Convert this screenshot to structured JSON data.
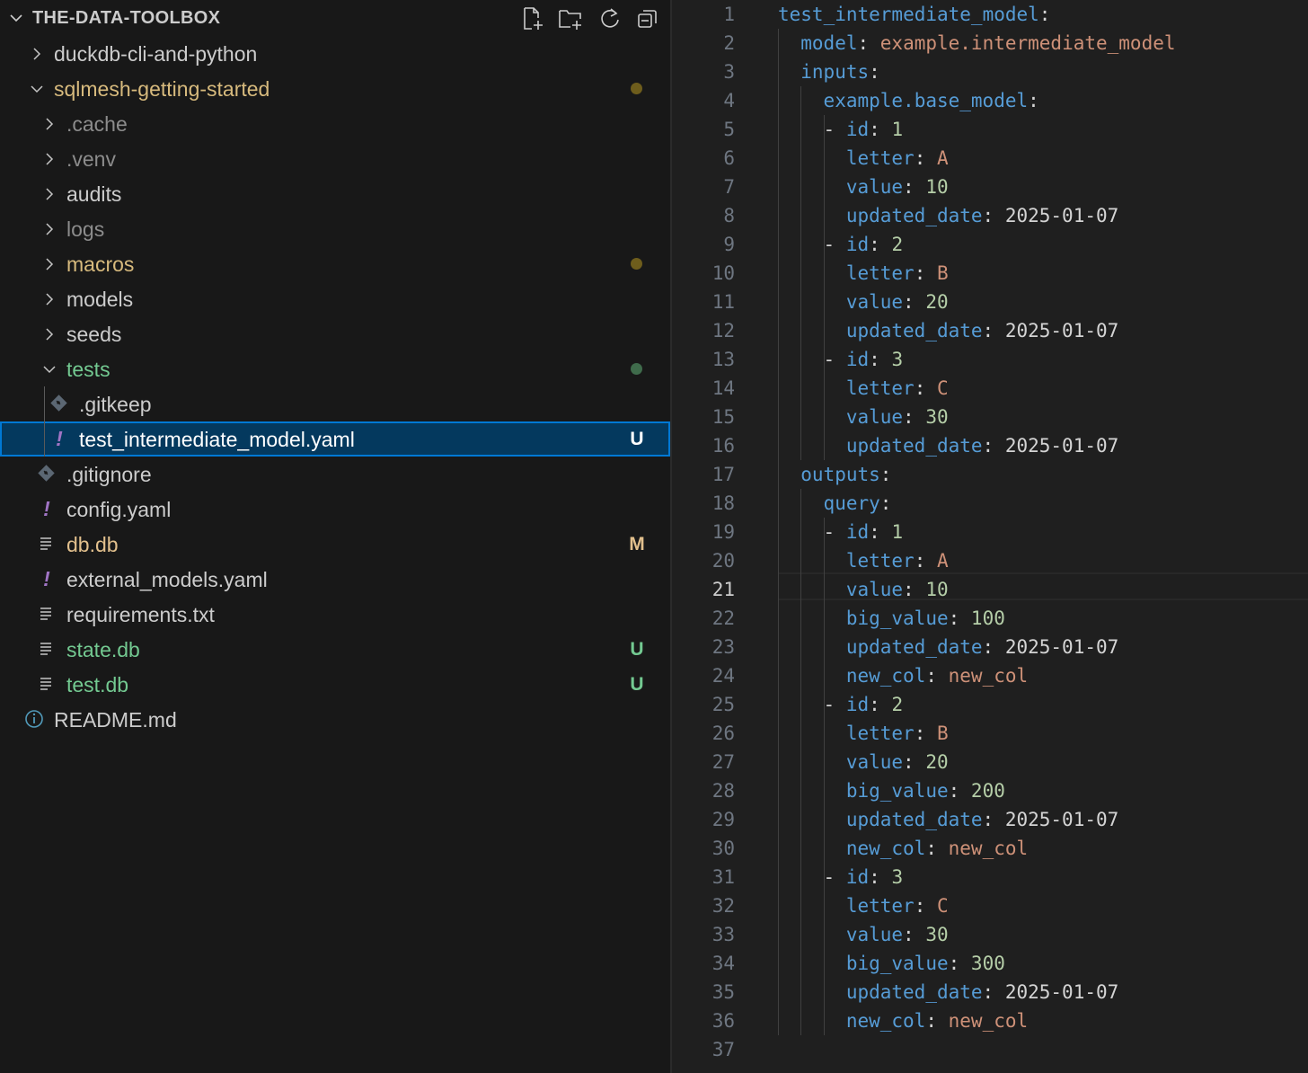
{
  "explorer": {
    "title": "THE-DATA-TOOLBOX",
    "actions": [
      "new-file-icon",
      "new-folder-icon",
      "refresh-icon",
      "collapse-all-icon"
    ],
    "items": [
      {
        "label": "duckdb-cli-and-python",
        "type": "folder",
        "expanded": false,
        "depth": 0,
        "status": "default"
      },
      {
        "label": "sqlmesh-getting-started",
        "type": "folder",
        "expanded": true,
        "depth": 0,
        "status": "modified",
        "decoration": "dot",
        "dot_color": "#6e5d1c"
      },
      {
        "label": ".cache",
        "type": "folder",
        "expanded": false,
        "depth": 1,
        "status": "ignored"
      },
      {
        "label": ".venv",
        "type": "folder",
        "expanded": false,
        "depth": 1,
        "status": "ignored"
      },
      {
        "label": "audits",
        "type": "folder",
        "expanded": false,
        "depth": 1,
        "status": "default"
      },
      {
        "label": "logs",
        "type": "folder",
        "expanded": false,
        "depth": 1,
        "status": "ignored"
      },
      {
        "label": "macros",
        "type": "folder",
        "expanded": false,
        "depth": 1,
        "status": "modified",
        "decoration": "dot",
        "dot_color": "#6e5d1c"
      },
      {
        "label": "models",
        "type": "folder",
        "expanded": false,
        "depth": 1,
        "status": "default"
      },
      {
        "label": "seeds",
        "type": "folder",
        "expanded": false,
        "depth": 1,
        "status": "default"
      },
      {
        "label": "tests",
        "type": "folder",
        "expanded": true,
        "depth": 1,
        "status": "untracked",
        "decoration": "dot",
        "dot_color": "#3f6b4b"
      },
      {
        "label": ".gitkeep",
        "type": "file",
        "icon": "git-icon",
        "depth": 2,
        "status": "default"
      },
      {
        "label": "test_intermediate_model.yaml",
        "type": "file",
        "icon": "yaml-icon",
        "depth": 2,
        "status": "selected",
        "badge": "U",
        "selected": true
      },
      {
        "label": ".gitignore",
        "type": "file",
        "icon": "git-icon",
        "depth": 1,
        "status": "default"
      },
      {
        "label": "config.yaml",
        "type": "file",
        "icon": "yaml-icon",
        "depth": 1,
        "status": "default"
      },
      {
        "label": "db.db",
        "type": "file",
        "icon": "text-file-icon",
        "depth": 1,
        "status": "dirty",
        "badge": "M"
      },
      {
        "label": "external_models.yaml",
        "type": "file",
        "icon": "yaml-icon",
        "depth": 1,
        "status": "default"
      },
      {
        "label": "requirements.txt",
        "type": "file",
        "icon": "text-file-icon",
        "depth": 1,
        "status": "default"
      },
      {
        "label": "state.db",
        "type": "file",
        "icon": "text-file-icon",
        "depth": 1,
        "status": "untracked",
        "badge": "U"
      },
      {
        "label": "test.db",
        "type": "file",
        "icon": "text-file-icon",
        "depth": 1,
        "status": "untracked",
        "badge": "U"
      },
      {
        "label": "README.md",
        "type": "file",
        "icon": "info-icon",
        "depth": 0,
        "status": "default"
      }
    ]
  },
  "editor": {
    "active_line": 21,
    "lines": [
      {
        "n": "1",
        "indent": 0,
        "tokens": [
          {
            "t": "test_intermediate_model",
            "c": "key"
          },
          {
            "t": ":",
            "c": "punc"
          }
        ]
      },
      {
        "n": "2",
        "indent": 1,
        "tokens": [
          {
            "t": "model",
            "c": "key"
          },
          {
            "t": ": ",
            "c": "punc"
          },
          {
            "t": "example.intermediate_model",
            "c": "str"
          }
        ]
      },
      {
        "n": "3",
        "indent": 1,
        "tokens": [
          {
            "t": "inputs",
            "c": "key"
          },
          {
            "t": ":",
            "c": "punc"
          }
        ]
      },
      {
        "n": "4",
        "indent": 2,
        "tokens": [
          {
            "t": "example.base_model",
            "c": "key"
          },
          {
            "t": ":",
            "c": "punc"
          }
        ]
      },
      {
        "n": "5",
        "indent": 2,
        "tokens": [
          {
            "t": "- ",
            "c": "plain"
          },
          {
            "t": "id",
            "c": "key"
          },
          {
            "t": ": ",
            "c": "punc"
          },
          {
            "t": "1",
            "c": "num"
          }
        ]
      },
      {
        "n": "6",
        "indent": 3,
        "tokens": [
          {
            "t": "letter",
            "c": "key"
          },
          {
            "t": ": ",
            "c": "punc"
          },
          {
            "t": "A",
            "c": "str"
          }
        ]
      },
      {
        "n": "7",
        "indent": 3,
        "tokens": [
          {
            "t": "value",
            "c": "key"
          },
          {
            "t": ": ",
            "c": "punc"
          },
          {
            "t": "10",
            "c": "num"
          }
        ]
      },
      {
        "n": "8",
        "indent": 3,
        "tokens": [
          {
            "t": "updated_date",
            "c": "key"
          },
          {
            "t": ": ",
            "c": "punc"
          },
          {
            "t": "2025-01-07",
            "c": "plain"
          }
        ]
      },
      {
        "n": "9",
        "indent": 2,
        "tokens": [
          {
            "t": "- ",
            "c": "plain"
          },
          {
            "t": "id",
            "c": "key"
          },
          {
            "t": ": ",
            "c": "punc"
          },
          {
            "t": "2",
            "c": "num"
          }
        ]
      },
      {
        "n": "10",
        "indent": 3,
        "tokens": [
          {
            "t": "letter",
            "c": "key"
          },
          {
            "t": ": ",
            "c": "punc"
          },
          {
            "t": "B",
            "c": "str"
          }
        ]
      },
      {
        "n": "11",
        "indent": 3,
        "tokens": [
          {
            "t": "value",
            "c": "key"
          },
          {
            "t": ": ",
            "c": "punc"
          },
          {
            "t": "20",
            "c": "num"
          }
        ]
      },
      {
        "n": "12",
        "indent": 3,
        "tokens": [
          {
            "t": "updated_date",
            "c": "key"
          },
          {
            "t": ": ",
            "c": "punc"
          },
          {
            "t": "2025-01-07",
            "c": "plain"
          }
        ]
      },
      {
        "n": "13",
        "indent": 2,
        "tokens": [
          {
            "t": "- ",
            "c": "plain"
          },
          {
            "t": "id",
            "c": "key"
          },
          {
            "t": ": ",
            "c": "punc"
          },
          {
            "t": "3",
            "c": "num"
          }
        ]
      },
      {
        "n": "14",
        "indent": 3,
        "tokens": [
          {
            "t": "letter",
            "c": "key"
          },
          {
            "t": ": ",
            "c": "punc"
          },
          {
            "t": "C",
            "c": "str"
          }
        ]
      },
      {
        "n": "15",
        "indent": 3,
        "tokens": [
          {
            "t": "value",
            "c": "key"
          },
          {
            "t": ": ",
            "c": "punc"
          },
          {
            "t": "30",
            "c": "num"
          }
        ]
      },
      {
        "n": "16",
        "indent": 3,
        "tokens": [
          {
            "t": "updated_date",
            "c": "key"
          },
          {
            "t": ": ",
            "c": "punc"
          },
          {
            "t": "2025-01-07",
            "c": "plain"
          }
        ]
      },
      {
        "n": "17",
        "indent": 1,
        "tokens": [
          {
            "t": "outputs",
            "c": "key"
          },
          {
            "t": ":",
            "c": "punc"
          }
        ]
      },
      {
        "n": "18",
        "indent": 2,
        "tokens": [
          {
            "t": "query",
            "c": "key"
          },
          {
            "t": ":",
            "c": "punc"
          }
        ]
      },
      {
        "n": "19",
        "indent": 2,
        "tokens": [
          {
            "t": "- ",
            "c": "plain"
          },
          {
            "t": "id",
            "c": "key"
          },
          {
            "t": ": ",
            "c": "punc"
          },
          {
            "t": "1",
            "c": "num"
          }
        ]
      },
      {
        "n": "20",
        "indent": 3,
        "tokens": [
          {
            "t": "letter",
            "c": "key"
          },
          {
            "t": ": ",
            "c": "punc"
          },
          {
            "t": "A",
            "c": "str"
          }
        ]
      },
      {
        "n": "21",
        "indent": 3,
        "tokens": [
          {
            "t": "value",
            "c": "key"
          },
          {
            "t": ": ",
            "c": "punc"
          },
          {
            "t": "10",
            "c": "num"
          }
        ]
      },
      {
        "n": "22",
        "indent": 3,
        "tokens": [
          {
            "t": "big_value",
            "c": "key"
          },
          {
            "t": ": ",
            "c": "punc"
          },
          {
            "t": "100",
            "c": "num"
          }
        ]
      },
      {
        "n": "23",
        "indent": 3,
        "tokens": [
          {
            "t": "updated_date",
            "c": "key"
          },
          {
            "t": ": ",
            "c": "punc"
          },
          {
            "t": "2025-01-07",
            "c": "plain"
          }
        ]
      },
      {
        "n": "24",
        "indent": 3,
        "tokens": [
          {
            "t": "new_col",
            "c": "key"
          },
          {
            "t": ": ",
            "c": "punc"
          },
          {
            "t": "new_col",
            "c": "str"
          }
        ]
      },
      {
        "n": "25",
        "indent": 2,
        "tokens": [
          {
            "t": "- ",
            "c": "plain"
          },
          {
            "t": "id",
            "c": "key"
          },
          {
            "t": ": ",
            "c": "punc"
          },
          {
            "t": "2",
            "c": "num"
          }
        ]
      },
      {
        "n": "26",
        "indent": 3,
        "tokens": [
          {
            "t": "letter",
            "c": "key"
          },
          {
            "t": ": ",
            "c": "punc"
          },
          {
            "t": "B",
            "c": "str"
          }
        ]
      },
      {
        "n": "27",
        "indent": 3,
        "tokens": [
          {
            "t": "value",
            "c": "key"
          },
          {
            "t": ": ",
            "c": "punc"
          },
          {
            "t": "20",
            "c": "num"
          }
        ]
      },
      {
        "n": "28",
        "indent": 3,
        "tokens": [
          {
            "t": "big_value",
            "c": "key"
          },
          {
            "t": ": ",
            "c": "punc"
          },
          {
            "t": "200",
            "c": "num"
          }
        ]
      },
      {
        "n": "29",
        "indent": 3,
        "tokens": [
          {
            "t": "updated_date",
            "c": "key"
          },
          {
            "t": ": ",
            "c": "punc"
          },
          {
            "t": "2025-01-07",
            "c": "plain"
          }
        ]
      },
      {
        "n": "30",
        "indent": 3,
        "tokens": [
          {
            "t": "new_col",
            "c": "key"
          },
          {
            "t": ": ",
            "c": "punc"
          },
          {
            "t": "new_col",
            "c": "str"
          }
        ]
      },
      {
        "n": "31",
        "indent": 2,
        "tokens": [
          {
            "t": "- ",
            "c": "plain"
          },
          {
            "t": "id",
            "c": "key"
          },
          {
            "t": ": ",
            "c": "punc"
          },
          {
            "t": "3",
            "c": "num"
          }
        ]
      },
      {
        "n": "32",
        "indent": 3,
        "tokens": [
          {
            "t": "letter",
            "c": "key"
          },
          {
            "t": ": ",
            "c": "punc"
          },
          {
            "t": "C",
            "c": "str"
          }
        ]
      },
      {
        "n": "33",
        "indent": 3,
        "tokens": [
          {
            "t": "value",
            "c": "key"
          },
          {
            "t": ": ",
            "c": "punc"
          },
          {
            "t": "30",
            "c": "num"
          }
        ]
      },
      {
        "n": "34",
        "indent": 3,
        "tokens": [
          {
            "t": "big_value",
            "c": "key"
          },
          {
            "t": ": ",
            "c": "punc"
          },
          {
            "t": "300",
            "c": "num"
          }
        ]
      },
      {
        "n": "35",
        "indent": 3,
        "tokens": [
          {
            "t": "updated_date",
            "c": "key"
          },
          {
            "t": ": ",
            "c": "punc"
          },
          {
            "t": "2025-01-07",
            "c": "plain"
          }
        ]
      },
      {
        "n": "36",
        "indent": 3,
        "tokens": [
          {
            "t": "new_col",
            "c": "key"
          },
          {
            "t": ": ",
            "c": "punc"
          },
          {
            "t": "new_col",
            "c": "str"
          }
        ]
      },
      {
        "n": "37",
        "indent": 0,
        "tokens": []
      }
    ]
  },
  "colors": {
    "selection_bg": "#04395e",
    "focus_border": "#0078d4",
    "untracked": "#73c991",
    "modified": "#e2c08d",
    "yaml_icon": "#a074c4",
    "yaml_key": "#569cd6",
    "yaml_string": "#ce9178",
    "yaml_number": "#b5cea8"
  }
}
